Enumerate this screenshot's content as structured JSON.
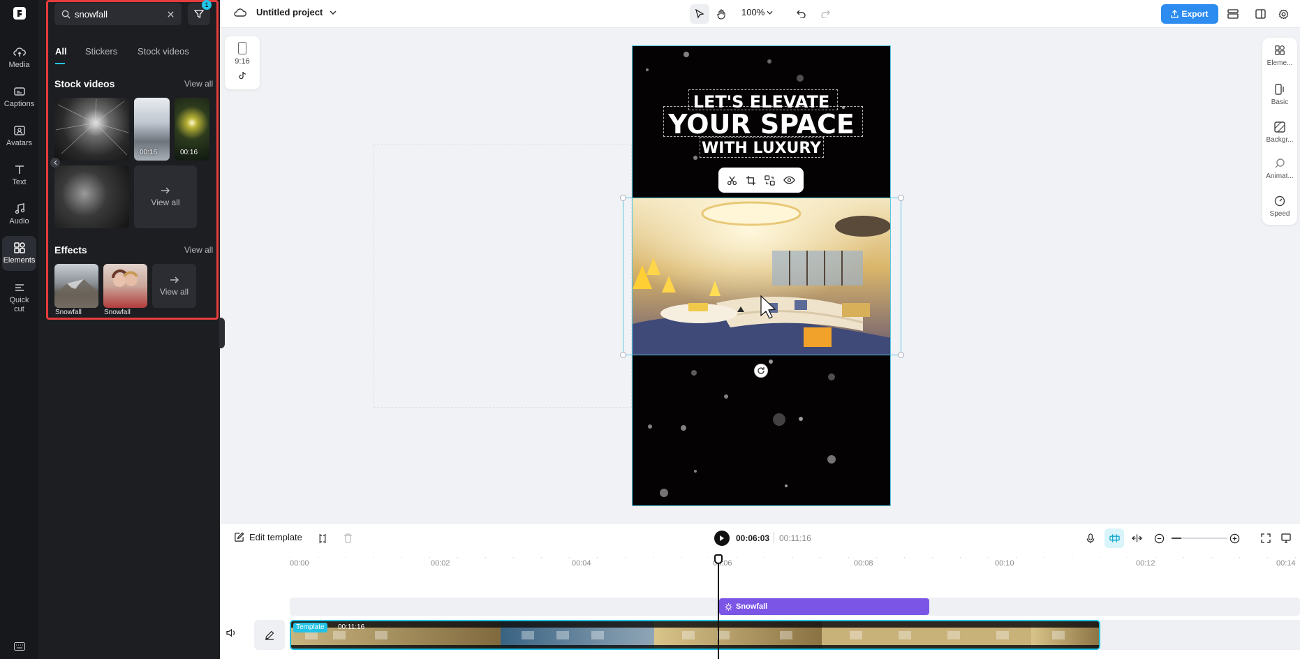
{
  "app": {
    "project_title": "Untitled project",
    "zoom": "100%",
    "export_label": "Export"
  },
  "rail": {
    "items": [
      {
        "id": "media",
        "label": "Media"
      },
      {
        "id": "captions",
        "label": "Captions"
      },
      {
        "id": "avatars",
        "label": "Avatars"
      },
      {
        "id": "text",
        "label": "Text"
      },
      {
        "id": "audio",
        "label": "Audio"
      },
      {
        "id": "elements",
        "label": "Elements"
      },
      {
        "id": "quickcut",
        "label": "Quick cut"
      }
    ]
  },
  "panel": {
    "search_value": "snowfall",
    "filter_badge": "1",
    "tabs": [
      "All",
      "Stickers",
      "Stock videos"
    ],
    "stock_title": "Stock videos",
    "stock_view_all": "View all",
    "stock_items": [
      {
        "duration": ""
      },
      {
        "duration": "00:16"
      },
      {
        "duration": "00:16"
      },
      {
        "duration": ""
      }
    ],
    "stock_card_view_all": "View all",
    "effects_title": "Effects",
    "effects_view_all": "View all",
    "effects_items": [
      {
        "label": "Snowfall"
      },
      {
        "label": "Snowfall"
      }
    ],
    "effects_card_view_all": "View all"
  },
  "ratio": {
    "label": "9:16"
  },
  "canvas": {
    "line1": "LET'S ELEVATE",
    "line2": "YOUR SPACE",
    "line3": "WITH LUXURY"
  },
  "props": {
    "items": [
      "Eleme...",
      "Basic",
      "Backgr...",
      "Animat...",
      "Speed"
    ]
  },
  "timeline": {
    "edit_template": "Edit template",
    "current_time": "00:06:03",
    "total_time": "00:11:16",
    "ruler": [
      "00:00",
      "00:02",
      "00:04",
      "00:06",
      "00:08",
      "00:10",
      "00:12",
      "00:14"
    ],
    "effect_clip_label": "Snowfall",
    "template_badge": "Template",
    "template_duration": "00:11:16"
  },
  "colors": {
    "accent": "#22c3e6",
    "export": "#2d8cf0",
    "effect_clip": "#7a55e6",
    "highlight_border": "#e63c3c"
  }
}
